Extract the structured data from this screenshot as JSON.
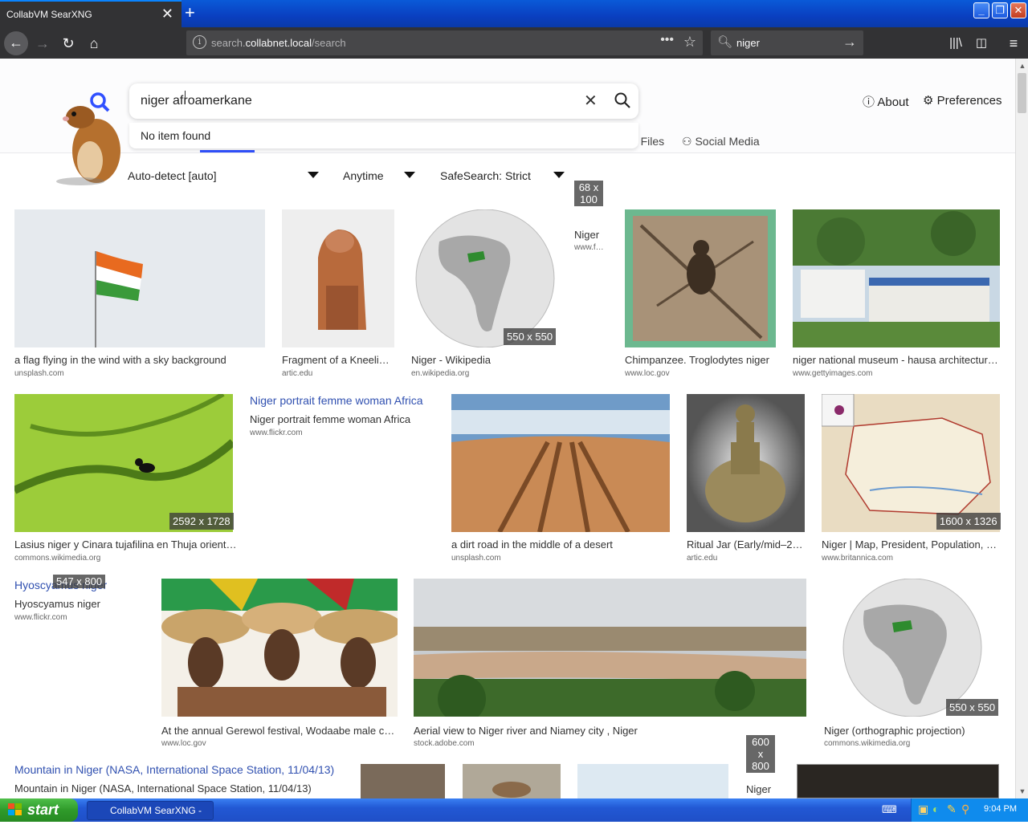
{
  "browser": {
    "tab_title": "CollabVM SearXNG",
    "url_prefix": "search.",
    "url_domain": "collabnet.local",
    "url_path": "/search",
    "search_query": "niger"
  },
  "header": {
    "search_value": "niger afroamerkane",
    "dropdown_text": "No item found",
    "about": "About",
    "preferences": "Preferences",
    "tabs": [
      "Files",
      "Social Media"
    ]
  },
  "filters": {
    "language": "Auto-detect [auto]",
    "time": "Anytime",
    "safesearch": "SafeSearch: Strict"
  },
  "results": [
    {
      "caption": "a flag flying in the wind with a sky background",
      "source": "unsplash.com"
    },
    {
      "caption": "Fragment of a Kneeli…",
      "source": "artic.edu"
    },
    {
      "caption": "Niger - Wikipedia",
      "source": "en.wikipedia.org",
      "dimension": "550 x 550"
    },
    {
      "caption": "Niger",
      "source": "www.f…",
      "dimension": "68 x 100"
    },
    {
      "caption": "Chimpanzee. Troglodytes niger",
      "source": "www.loc.gov"
    },
    {
      "caption": "niger national museum - hausa architectur…",
      "source": "www.gettyimages.com"
    },
    {
      "caption": "Lasius niger y Cinara tujafilina en Thuja orient…",
      "source": "commons.wikimedia.org",
      "dimension": "2592 x 1728"
    },
    {
      "title": "Niger portrait femme woman Africa",
      "caption": "Niger portrait femme woman Africa",
      "source": "www.flickr.com"
    },
    {
      "caption": "a dirt road in the middle of a desert",
      "source": "unsplash.com"
    },
    {
      "caption": "Ritual Jar (Early/mid–2…",
      "source": "artic.edu"
    },
    {
      "caption": "Niger | Map, President, Population, …",
      "source": "www.britannica.com",
      "dimension": "1600 x 1326"
    },
    {
      "title": "Hyoscyamus niger",
      "caption": "Hyoscyamus niger",
      "source": "www.flickr.com",
      "dimension": "547 x 800"
    },
    {
      "caption": "At the annual Gerewol festival, Wodaabe male c…",
      "source": "www.loc.gov"
    },
    {
      "caption": "Aerial view to Niger river and Niamey city , Niger",
      "source": "stock.adobe.com"
    },
    {
      "caption": "Niger (orthographic projection)",
      "source": "commons.wikimedia.org",
      "dimension": "550 x 550"
    },
    {
      "title": "Mountain in Niger (NASA, International Space Station, 11/04/13)",
      "caption": "Mountain in Niger (NASA, International Space Station, 11/04/13)"
    },
    {
      "caption": "Niger",
      "dimension": "600 x 800"
    }
  ],
  "taskbar": {
    "start": "start",
    "task_item": "CollabVM SearXNG - …",
    "clock": "9:04 PM"
  }
}
